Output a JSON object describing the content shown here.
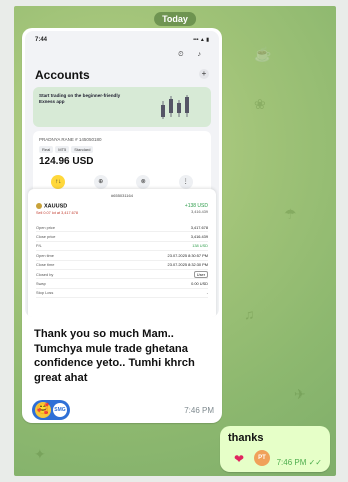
{
  "date_label": "Today",
  "screenshot": {
    "time": "7:44",
    "status_icons": "••• ▲ ▮",
    "header_icons": "⏲ ♪",
    "title": "Accounts",
    "add_symbol": "+",
    "promo_text": "Start trading on the beginner-friendly Exness app",
    "account_label": "PRADNYA RANE  # 145050180",
    "tags": [
      "Real",
      "MT5",
      "Standard"
    ],
    "balance": "124.96 USD",
    "actions": [
      {
        "label": "Trade",
        "icon": "↑↓"
      },
      {
        "label": "Deposit",
        "icon": "⊕"
      },
      {
        "label": "Withdraw",
        "icon": "⊗"
      },
      {
        "label": "Details",
        "icon": "⋮"
      }
    ],
    "order_id": "#655031164",
    "symbol": "XAUUSD",
    "symbol_sub": "Sell 0.07 lot at 3,417.678",
    "profit": "+138 USD",
    "profit_sub": "3,416.439",
    "rows": [
      {
        "k": "Open price",
        "v": "3,417.678"
      },
      {
        "k": "Close price",
        "v": "3,416.439"
      },
      {
        "k": "P/L",
        "v": "138 USD"
      },
      {
        "k": "Open time",
        "v": "23.07.2025 8:30:57 PM"
      },
      {
        "k": "Close time",
        "v": "23.07.2025 8:32:30 PM"
      },
      {
        "k": "Closed by",
        "v": "User"
      },
      {
        "k": "Swap",
        "v": "0.00 USD"
      },
      {
        "k": "Stop Loss",
        "v": "-"
      }
    ]
  },
  "message_in": {
    "text": "Thank you so much Mam.. Tumchya mule trade ghetana confidence yeto.. Tumhi khrch great ahat",
    "time": "7:46 PM",
    "reaction_emoji": "🥰",
    "reaction_avatar": "SMG"
  },
  "message_out": {
    "text": "thanks",
    "reaction": "❤",
    "reaction_avatar": "PT",
    "time": "7:46 PM ✓✓"
  }
}
